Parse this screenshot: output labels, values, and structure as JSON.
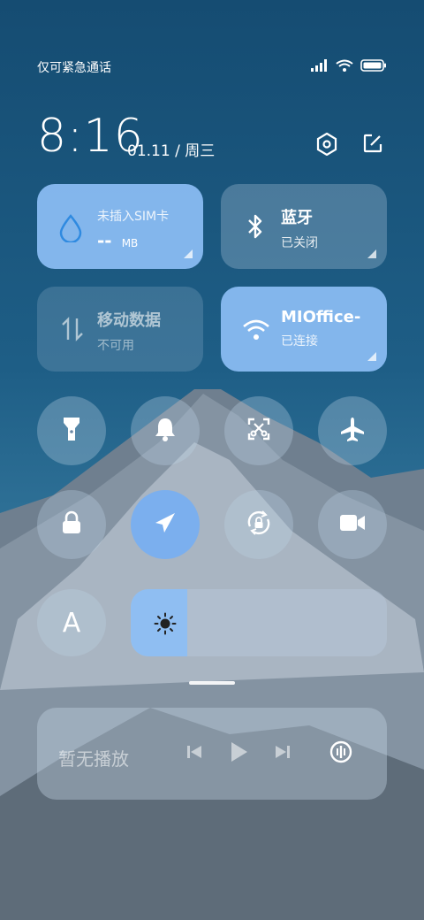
{
  "status_bar": {
    "carrier_text": "仅可紧急通话"
  },
  "header": {
    "time": "8:16",
    "date": "01.11 / 周三"
  },
  "tiles": {
    "data_usage": {
      "label": "未插入SIM卡",
      "value": "--",
      "unit": "MB"
    },
    "bluetooth": {
      "title": "蓝牙",
      "status": "已关闭"
    },
    "mobile_data": {
      "title": "移动数据",
      "status": "不可用"
    },
    "wifi": {
      "title": "MIOffice-",
      "status": "已连接"
    }
  },
  "toggles": {
    "flashlight": "flashlight-icon",
    "bell": "bell-icon",
    "screenshot": "screenshot-icon",
    "airplane": "airplane-icon",
    "lock": "lock-icon",
    "location": "location-icon",
    "rotation": "rotation-lock-icon",
    "video": "video-camera-icon",
    "auto_brightness": "A"
  },
  "brightness": {
    "level_fraction": 0.22
  },
  "media": {
    "status": "暂无播放"
  },
  "colors": {
    "tile_active": "#8cbef5",
    "tile_inactive": "#bed2e6",
    "toggle_active": "#78aff0"
  }
}
